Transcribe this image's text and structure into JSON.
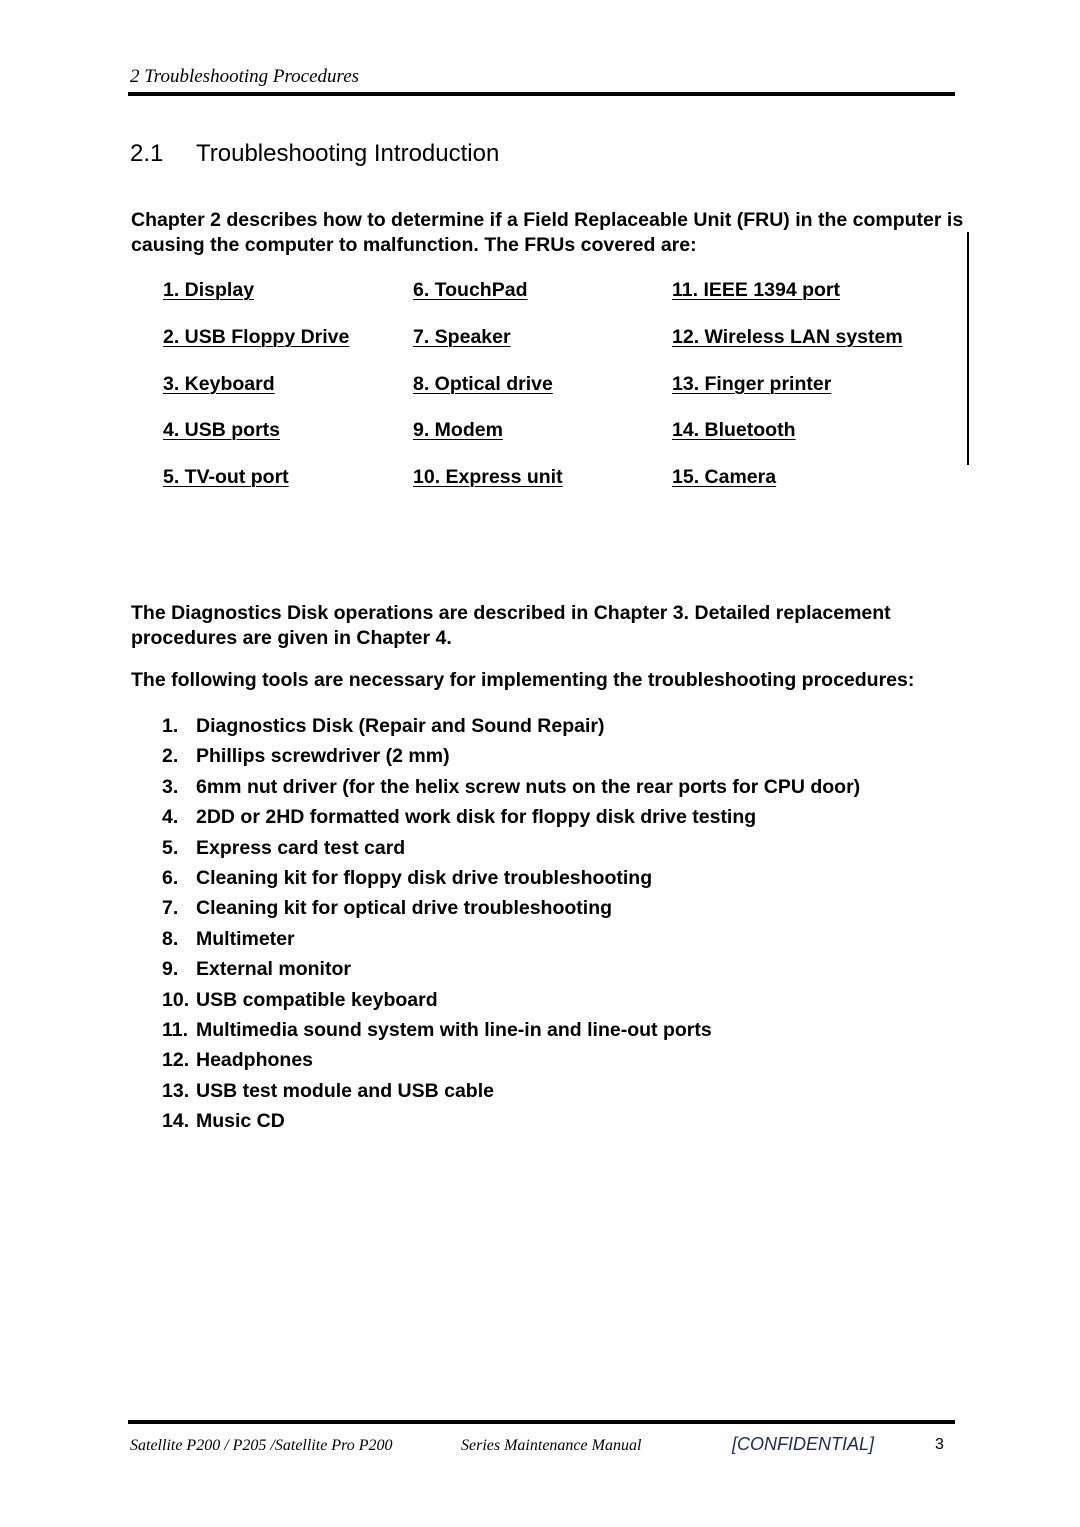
{
  "header": {
    "chapter": "2 Troubleshooting Procedures"
  },
  "section": {
    "number": "2.1",
    "title": "Troubleshooting Introduction"
  },
  "intro": "Chapter 2 describes how to determine if a Field Replaceable Unit (FRU) in the computer is causing the computer to malfunction.  The FRUs covered are:",
  "frus": [
    [
      "1. Display",
      "6. TouchPad",
      "11. IEEE 1394 port"
    ],
    [
      "2. USB Floppy Drive",
      "7. Speaker",
      "12. Wireless LAN system"
    ],
    [
      "3. Keyboard",
      "8. Optical drive",
      "13. Finger printer"
    ],
    [
      "4. USB ports",
      "9. Modem",
      "14. Bluetooth"
    ],
    [
      "5.  TV-out port",
      "10. Express unit",
      "15. Camera"
    ]
  ],
  "para2": "The Diagnostics Disk operations are described in Chapter 3.  Detailed replacement procedures are given in Chapter 4.",
  "para3": "The following tools are necessary for implementing the troubleshooting procedures:",
  "tools": [
    {
      "n": "1.",
      "t": "Diagnostics Disk (Repair and Sound Repair)"
    },
    {
      "n": "2.",
      "t": "Phillips screwdriver (2 mm)"
    },
    {
      "n": "3.",
      "t": "6mm nut driver (for the helix screw nuts on the rear ports for CPU door)"
    },
    {
      "n": "4.",
      "t": "2DD or 2HD formatted work disk for floppy disk drive testing"
    },
    {
      "n": "5.",
      "t": "Express card test card"
    },
    {
      "n": "6.",
      "t": "Cleaning kit for floppy disk drive troubleshooting"
    },
    {
      "n": "7.",
      "t": "Cleaning kit for optical drive troubleshooting"
    },
    {
      "n": "8.",
      "t": "Multimeter"
    },
    {
      "n": "9.",
      "t": "External monitor"
    },
    {
      "n": "10.",
      "t": "USB compatible keyboard"
    },
    {
      "n": "11.",
      "t": "Multimedia sound system with line-in and line-out ports"
    },
    {
      "n": "12.",
      "t": "Headphones"
    },
    {
      "n": "13.",
      "t": "USB test module and USB cable"
    },
    {
      "n": "14.",
      "t": "Music CD"
    }
  ],
  "footer": {
    "model": "Satellite P200 / P205 /Satellite Pro P200",
    "manual": "Series Maintenance Manual",
    "confidential": "[CONFIDENTIAL]",
    "page": "3",
    "confidential_color": "#1f2a5a"
  }
}
